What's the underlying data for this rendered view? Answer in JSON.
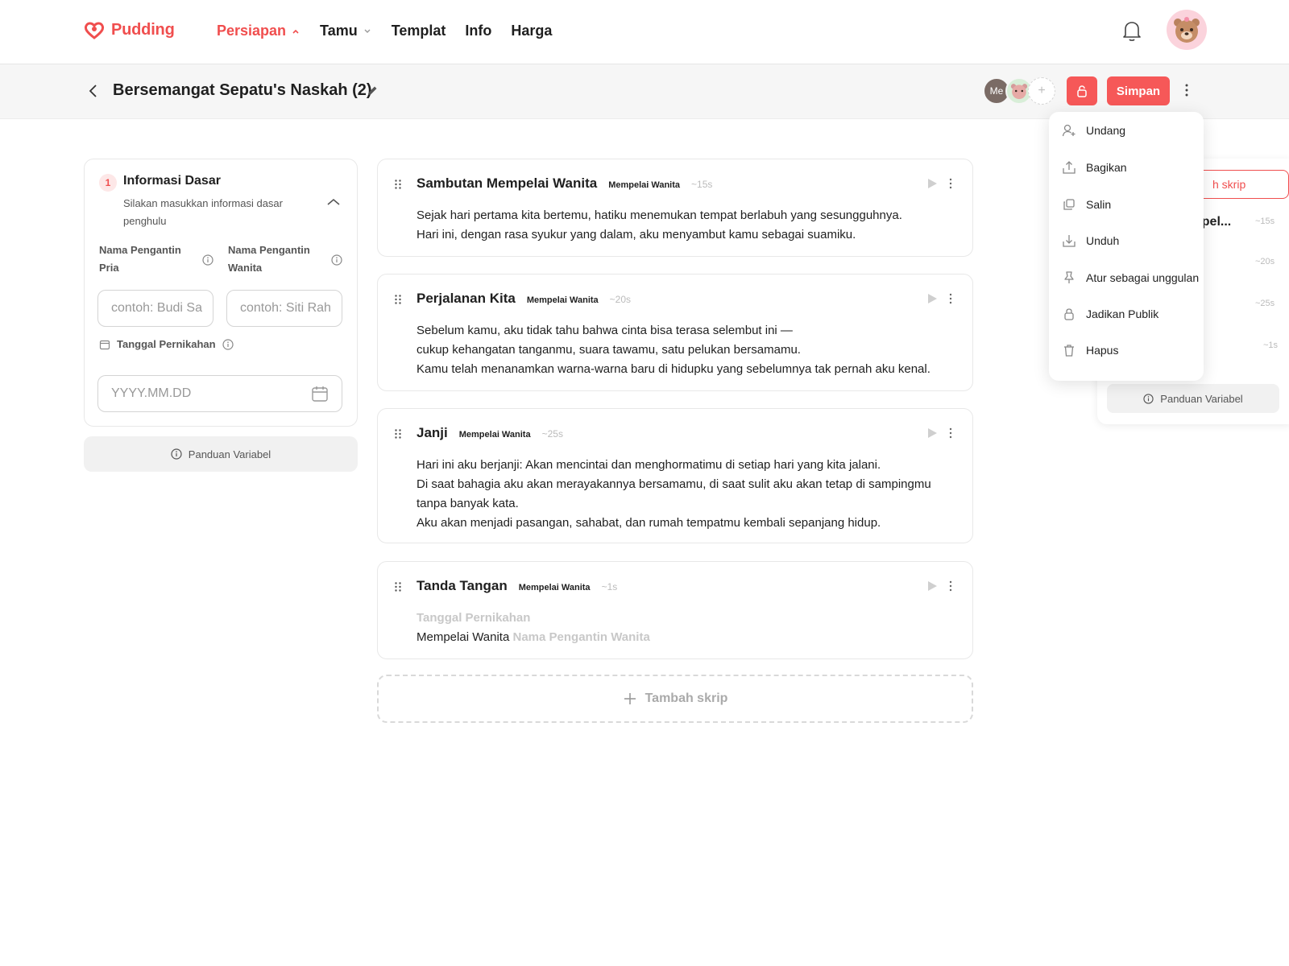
{
  "brand": {
    "name": "Pudding",
    "accent": "#f04e4e"
  },
  "nav": [
    {
      "label": "Persiapan",
      "active": true,
      "has_menu": true
    },
    {
      "label": "Tamu",
      "active": false,
      "has_menu": true
    },
    {
      "label": "Templat",
      "active": false,
      "has_menu": false
    },
    {
      "label": "Info",
      "active": false,
      "has_menu": false
    },
    {
      "label": "Harga",
      "active": false,
      "has_menu": false
    }
  ],
  "header": {
    "title": "Bersemangat Sepatu's Naskah (2)",
    "collaborators": {
      "me_label": "Me",
      "add_label": "+"
    },
    "save_label": "Simpan"
  },
  "info_panel": {
    "step": "1",
    "title": "Informasi Dasar",
    "description": "Silakan masukkan informasi dasar penghulu",
    "groom_label": "Nama Pengantin Pria",
    "groom_placeholder": "contoh: Budi Sa",
    "bride_label": "Nama Pengantin Wanita",
    "bride_placeholder": "contoh: Siti Rah",
    "date_label": "Tanggal Pernikahan",
    "date_placeholder": "YYYY.MM.DD",
    "guide_label": "Panduan Variabel"
  },
  "scripts": [
    {
      "title": "Sambutan Mempelai Wanita",
      "role": "Mempelai Wanita",
      "duration": "~15s",
      "lines": [
        "Sejak hari pertama kita bertemu, hatiku menemukan tempat berlabuh yang sesungguhnya.",
        "Hari ini, dengan rasa syukur yang dalam, aku menyambut kamu sebagai suamiku."
      ]
    },
    {
      "title": "Perjalanan Kita",
      "role": "Mempelai Wanita",
      "duration": "~20s",
      "lines": [
        "Sebelum kamu, aku tidak tahu bahwa cinta bisa terasa selembut ini —",
        "cukup kehangatan tanganmu, suara tawamu, satu pelukan bersamamu.",
        "Kamu telah menanamkan warna-warna baru di hidupku yang sebelumnya tak pernah aku kenal."
      ]
    },
    {
      "title": "Janji",
      "role": "Mempelai Wanita",
      "duration": "~25s",
      "lines": [
        "Hari ini aku berjanji: Akan mencintai dan menghormatimu di setiap hari yang kita jalani.",
        "Di saat bahagia aku akan merayakannya bersamamu, di saat sulit aku akan tetap di sampingmu",
        "tanpa banyak kata.",
        "Aku akan menjadi pasangan, sahabat, dan rumah tempatmu kembali sepanjang hidup."
      ]
    },
    {
      "title": "Tanda Tangan",
      "role": "Mempelai Wanita",
      "duration": "~1s",
      "var_date": "Tanggal Pernikahan",
      "signer_prefix": "Mempelai Wanita",
      "var_name": "Nama Pengantin Wanita"
    }
  ],
  "add_script_label": "Tambah skrip",
  "side_panel": {
    "add_label": "h skrip",
    "items": [
      {
        "title": "npel...",
        "duration": "~15s"
      },
      {
        "title": "",
        "duration": "~20s"
      },
      {
        "title": "",
        "duration": "~25s"
      },
      {
        "title": "",
        "duration": "~1s"
      }
    ],
    "guide_label": "Panduan Variabel"
  },
  "menu": [
    {
      "label": "Undang",
      "icon": "user-plus-icon"
    },
    {
      "label": "Bagikan",
      "icon": "share-icon"
    },
    {
      "label": "Salin",
      "icon": "copy-icon"
    },
    {
      "label": "Unduh",
      "icon": "download-icon"
    },
    {
      "label": "Atur sebagai unggulan",
      "icon": "pin-icon"
    },
    {
      "label": "Jadikan Publik",
      "icon": "lock-icon"
    },
    {
      "label": "Hapus",
      "icon": "trash-icon"
    }
  ]
}
